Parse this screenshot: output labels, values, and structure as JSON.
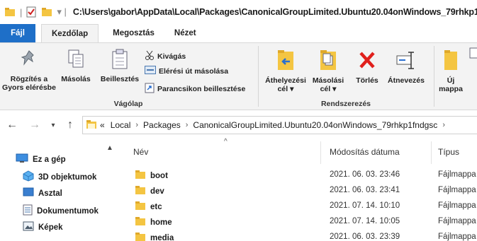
{
  "window": {
    "title": "C:\\Users\\gabor\\AppData\\Local\\Packages\\CanonicalGroupLimited.Ubuntu20.04onWindows_79rhkp1"
  },
  "tabs": [
    "Fájl",
    "Kezdőlap",
    "Megosztás",
    "Nézet"
  ],
  "ribbon": {
    "clipboard": {
      "pin_label_1": "Rögzítés a",
      "pin_label_2": "Gyors elérésbe",
      "copy_label": "Másolás",
      "paste_label": "Beillesztés",
      "cut_label": "Kivágás",
      "copy_path_label": "Elérési út másolása",
      "paste_shortcut_label": "Parancsikon beillesztése",
      "group_label": "Vágólap"
    },
    "organize": {
      "move_label_1": "Áthelyezési",
      "move_label_2": "cél",
      "copyto_label_1": "Másolási",
      "copyto_label_2": "cél",
      "delete_label": "Törlés",
      "rename_label": "Átnevezés",
      "group_label": "Rendszerezés"
    },
    "new": {
      "newfolder_label_1": "Új",
      "newfolder_label_2": "mappa"
    }
  },
  "address": {
    "overflow": "«",
    "crumbs": [
      "Local",
      "Packages",
      "CanonicalGroupLimited.Ubuntu20.04onWindows_79rhkp1fndgsc"
    ],
    "sep": "›"
  },
  "navpane": {
    "items": [
      "Ez a gép",
      "3D objektumok",
      "Asztal",
      "Dokumentumok",
      "Képek"
    ]
  },
  "columns": {
    "name": "Név",
    "modified": "Módosítás dátuma",
    "type": "Típus"
  },
  "files": [
    {
      "name": "boot",
      "modified": "2021. 06. 03. 23:46",
      "type": "Fájlmappa"
    },
    {
      "name": "dev",
      "modified": "2021. 06. 03. 23:41",
      "type": "Fájlmappa"
    },
    {
      "name": "etc",
      "modified": "2021. 07. 14. 10:10",
      "type": "Fájlmappa"
    },
    {
      "name": "home",
      "modified": "2021. 07. 14. 10:05",
      "type": "Fájlmappa"
    },
    {
      "name": "media",
      "modified": "2021. 06. 03. 23:39",
      "type": "Fájlmappa"
    }
  ],
  "colors": {
    "accent": "#1e6fc8",
    "folder": "#f4c542",
    "delete": "#e0201c"
  }
}
